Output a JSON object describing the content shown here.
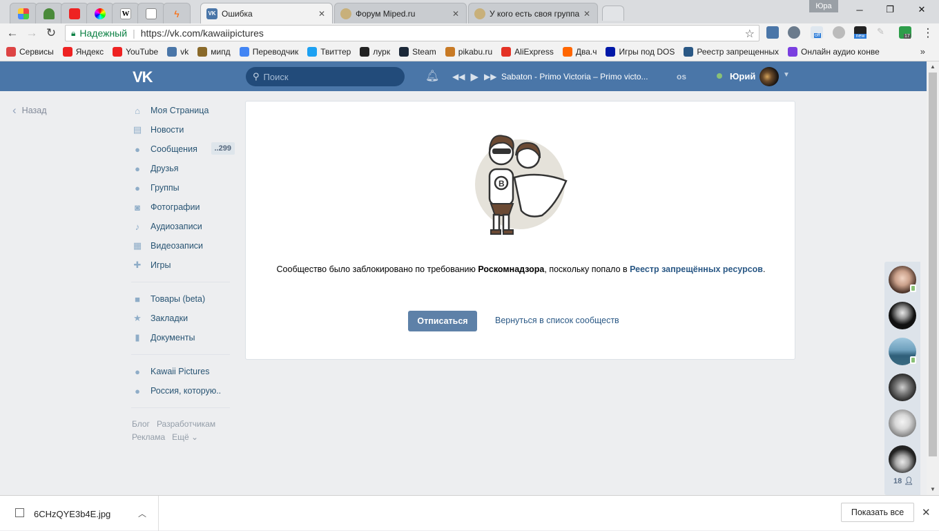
{
  "browser": {
    "profile_name": "Юра",
    "tabs": [
      {
        "title": "Ошибка",
        "icon": "vk-icon",
        "active": true
      },
      {
        "title": "Форум Miped.ru",
        "icon": "miped-icon"
      },
      {
        "title": "У кого есть своя группа",
        "icon": "miped-icon"
      }
    ],
    "address": {
      "secure_label": "Надежный",
      "url": "https://vk.com/kawaiipictures"
    },
    "ext_badges": {
      "off": "off",
      "new": "new",
      "count": "17"
    },
    "bookmarks": [
      {
        "label": "Сервисы",
        "color": "#d44"
      },
      {
        "label": "Яндекс",
        "color": "#e22"
      },
      {
        "label": "YouTube",
        "color": "#e22"
      },
      {
        "label": "vk",
        "color": "#4a76a8"
      },
      {
        "label": "мипд",
        "color": "#8a6a2a"
      },
      {
        "label": "Переводчик",
        "color": "#4285f4"
      },
      {
        "label": "Твиттер",
        "color": "#1da1f2"
      },
      {
        "label": "лурк",
        "color": "#222"
      },
      {
        "label": "Steam",
        "color": "#1b2838"
      },
      {
        "label": "pikabu.ru",
        "color": "#c87a25"
      },
      {
        "label": "AliExpress",
        "color": "#e43225"
      },
      {
        "label": "Два.ч",
        "color": "#f60"
      },
      {
        "label": "Игры под DOS",
        "color": "#0018a8"
      },
      {
        "label": "Реестр запрещенных",
        "color": "#2a5885"
      },
      {
        "label": "Онлайн аудио конве",
        "color": "#7a3fe0"
      }
    ]
  },
  "vk": {
    "logo": "VK",
    "search_placeholder": "Поиск",
    "track": "Sabaton - Primo Victoria – Primo victo...",
    "lastfm": "os",
    "user_name": "Юрий",
    "back": "Назад",
    "menu": [
      {
        "label": "Моя Страница",
        "icon": "home-icon",
        "glyph": "⌂"
      },
      {
        "label": "Новости",
        "icon": "news-icon",
        "glyph": "▤"
      },
      {
        "label": "Сообщения",
        "icon": "messages-icon",
        "glyph": "●",
        "badge": "..299"
      },
      {
        "label": "Друзья",
        "icon": "friends-icon",
        "glyph": "●"
      },
      {
        "label": "Группы",
        "icon": "groups-icon",
        "glyph": "●"
      },
      {
        "label": "Фотографии",
        "icon": "camera-icon",
        "glyph": "◙"
      },
      {
        "label": "Аудиозаписи",
        "icon": "music-icon",
        "glyph": "♪"
      },
      {
        "label": "Видеозаписи",
        "icon": "video-icon",
        "glyph": "▦"
      },
      {
        "label": "Игры",
        "icon": "gamepad-icon",
        "glyph": "✚"
      }
    ],
    "menu2": [
      {
        "label": "Товары (beta)",
        "icon": "bag-icon",
        "glyph": "■"
      },
      {
        "label": "Закладки",
        "icon": "star-icon",
        "glyph": "★"
      },
      {
        "label": "Документы",
        "icon": "document-icon",
        "glyph": "▮"
      }
    ],
    "menu3": [
      {
        "label": "Kawaii Pictures",
        "icon": "group-icon",
        "glyph": "●"
      },
      {
        "label": "Россия, которую..",
        "icon": "group-icon",
        "glyph": "●"
      }
    ],
    "footer": {
      "blog": "Блог",
      "dev": "Разработчикам",
      "ads": "Реклама",
      "more": "Ещё ⌄"
    },
    "blocked": {
      "text_before": "Сообщество было заблокировано по требованию ",
      "authority": "Роскомнадзора",
      "text_mid": ", поскольку попало в ",
      "registry": "Реестр запрещённых ресурсов",
      "text_end": ".",
      "unsubscribe": "Отписаться",
      "back_to_list": "Вернуться в список сообществ"
    },
    "friends_count": "18"
  },
  "download": {
    "filename": "6CHzQYE3b4E.jpg",
    "show_all": "Показать все"
  }
}
